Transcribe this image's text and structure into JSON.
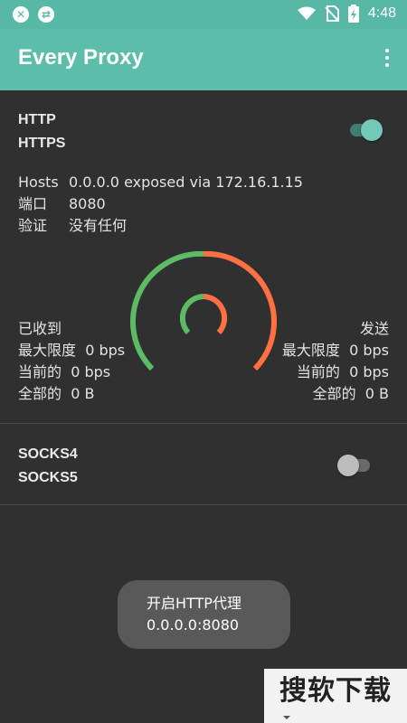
{
  "app": {
    "title": "Every Proxy"
  },
  "status_bar": {
    "time": "4:48"
  },
  "http_section": {
    "proto1": "HTTP",
    "proto2": "HTTPS",
    "enabled": true,
    "hosts_label": "Hosts",
    "hosts_value": "0.0.0.0 exposed via 172.16.1.15",
    "port_label": "端口",
    "port_value": "8080",
    "auth_label": "验证",
    "auth_value": "没有任何"
  },
  "stats": {
    "received_title": "已收到",
    "sent_title": "发送",
    "max_label": "最大限度",
    "current_label": "当前的",
    "total_label": "全部的",
    "rx_max": "0 bps",
    "rx_current": "0 bps",
    "rx_total": "0 B",
    "tx_max": "0 bps",
    "tx_current": "0 bps",
    "tx_total": "0 B"
  },
  "socks_section": {
    "proto1": "SOCKS4",
    "proto2": "SOCKS5",
    "enabled": false
  },
  "toast": {
    "line1": "开启HTTP代理",
    "line2": "0.0.0.0:8080"
  },
  "watermark": {
    "text": "搜软下载"
  },
  "colors": {
    "accent": "#5dbdab",
    "gauge_received": "#5dbb63",
    "gauge_sent": "#ff7043",
    "background": "#303030"
  }
}
